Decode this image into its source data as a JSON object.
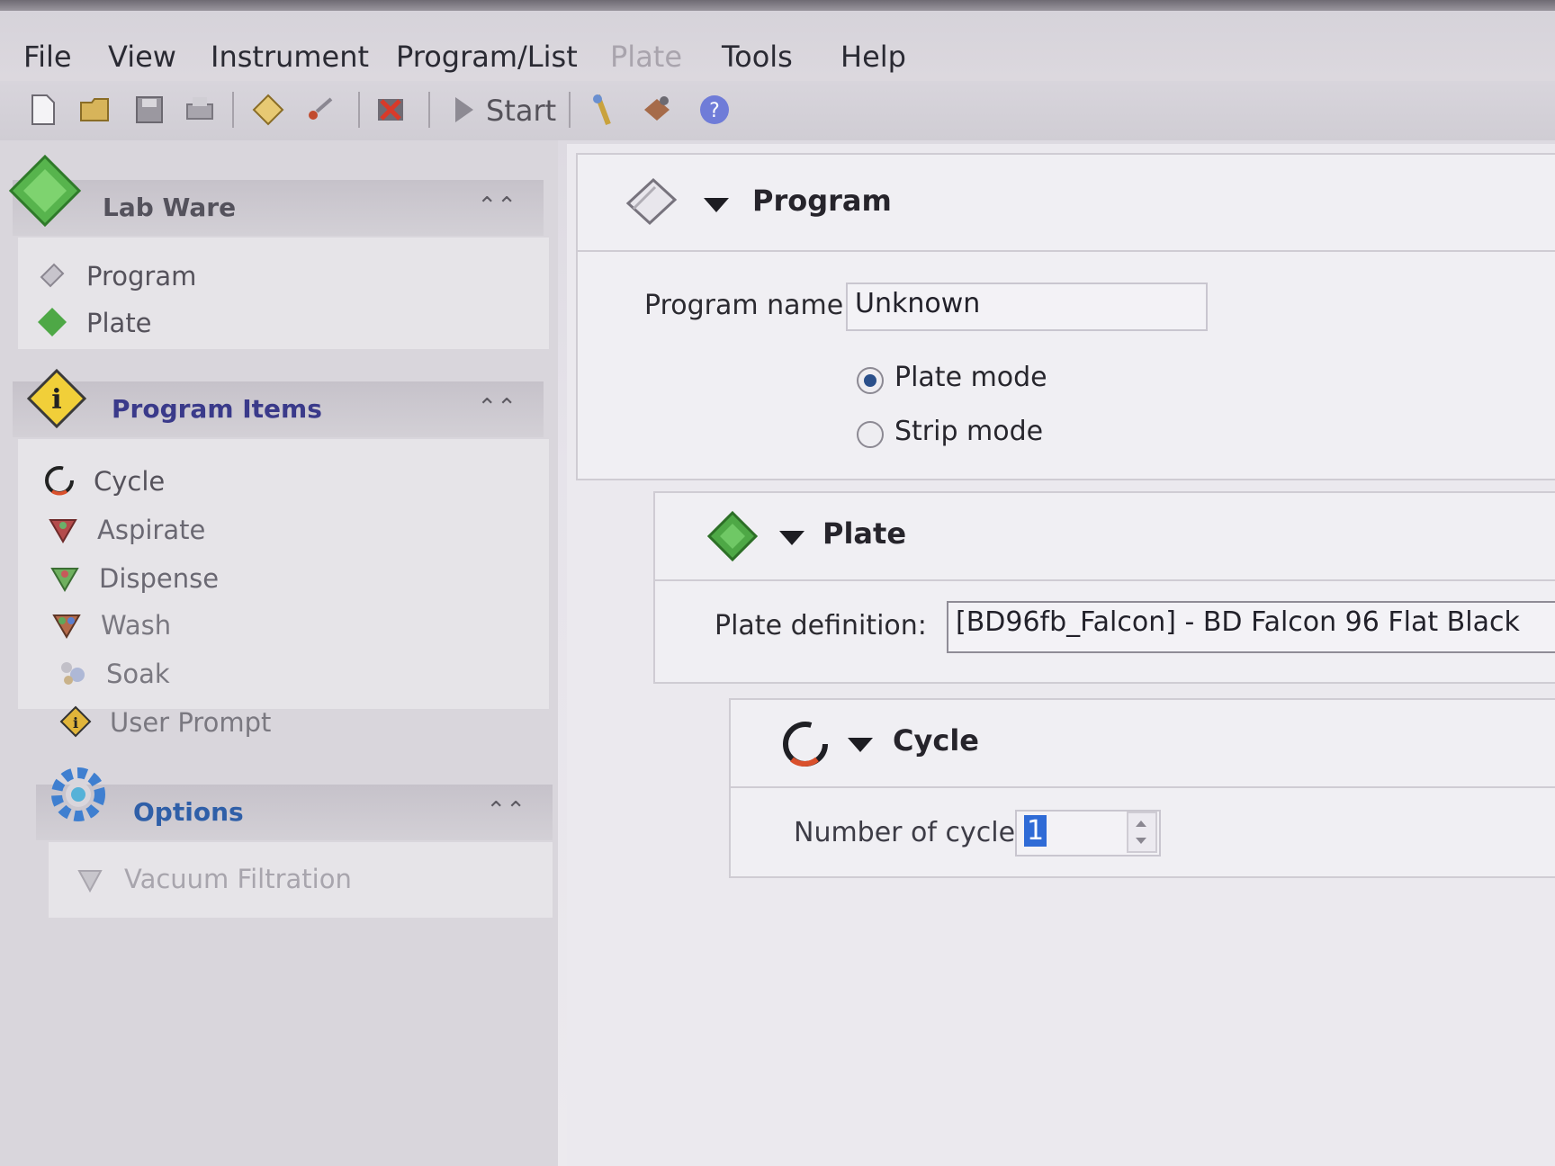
{
  "menu": {
    "items": [
      "File",
      "View",
      "Instrument",
      "Program/List",
      "Plate",
      "Tools",
      "Help"
    ]
  },
  "toolbar": {
    "start_label": "Start",
    "icons": [
      "new-file-icon",
      "open-folder-icon",
      "save-icon",
      "print-icon",
      "diamond-icon",
      "connect-icon",
      "stop-icon",
      "start-icon",
      "tool-icon",
      "plate-tool-icon",
      "help-icon"
    ]
  },
  "sidebar": {
    "labware": {
      "title": "Lab Ware",
      "items": [
        {
          "label": "Program",
          "icon": "program-icon"
        },
        {
          "label": "Plate",
          "icon": "plate-icon"
        }
      ]
    },
    "program_items": {
      "title": "Program Items",
      "items": [
        {
          "label": "Cycle",
          "icon": "cycle-icon"
        },
        {
          "label": "Aspirate",
          "icon": "aspirate-icon"
        },
        {
          "label": "Dispense",
          "icon": "dispense-icon"
        },
        {
          "label": "Wash",
          "icon": "wash-icon"
        },
        {
          "label": "Soak",
          "icon": "soak-icon"
        },
        {
          "label": "User Prompt",
          "icon": "user-prompt-icon"
        }
      ]
    },
    "options": {
      "title": "Options",
      "items": [
        {
          "label": "Vacuum Filtration",
          "icon": "vacuum-icon"
        }
      ]
    }
  },
  "program_card": {
    "title": "Program",
    "name_label": "Program name",
    "name_value": "Unknown",
    "mode_options": [
      "Plate mode",
      "Strip mode"
    ],
    "selected_mode": "Plate mode"
  },
  "plate_card": {
    "title": "Plate",
    "definition_label": "Plate definition:",
    "definition_value": "[BD96fb_Falcon] - BD Falcon 96 Flat Black"
  },
  "cycle_card": {
    "title": "Cycle",
    "cycles_label": "Number of cycles:",
    "cycles_value": "1"
  },
  "colors": {
    "accent_green": "#3aa23a",
    "selection_blue": "#2f6bd6",
    "program_items_title": "#3a3a8a",
    "options_title": "#2f5fa8"
  }
}
